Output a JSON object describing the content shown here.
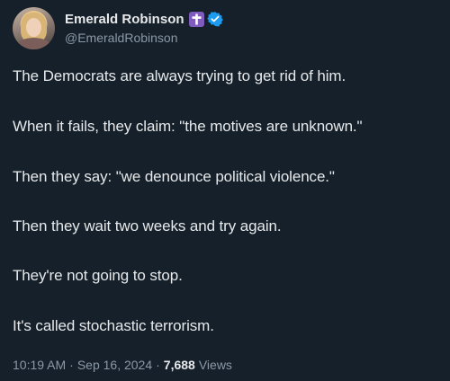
{
  "author": {
    "display_name": "Emerald Robinson",
    "handle": "@EmeraldRobinson",
    "avatar_icon": "profile-photo",
    "badges": {
      "cross_icon": "cross-icon",
      "cross_color": "#7f5bbd",
      "verified_icon": "verified-check-icon",
      "verified_color": "#1d9bf0"
    }
  },
  "tweet": {
    "lines": [
      "The Democrats are always trying to get rid of him.",
      "When it fails, they claim: \"the motives are unknown.\"",
      "Then they say: \"we denounce political violence.\"",
      "Then they wait two weeks and try again.",
      "They're not going to stop.",
      "It's called stochastic terrorism."
    ]
  },
  "meta": {
    "time": "10:19 AM",
    "separator": "·",
    "date": "Sep 16, 2024",
    "views_count": "7,688",
    "views_label": "Views"
  },
  "colors": {
    "background": "#15202b",
    "text_primary": "#e7e9ea",
    "text_secondary": "#8b98a5"
  }
}
